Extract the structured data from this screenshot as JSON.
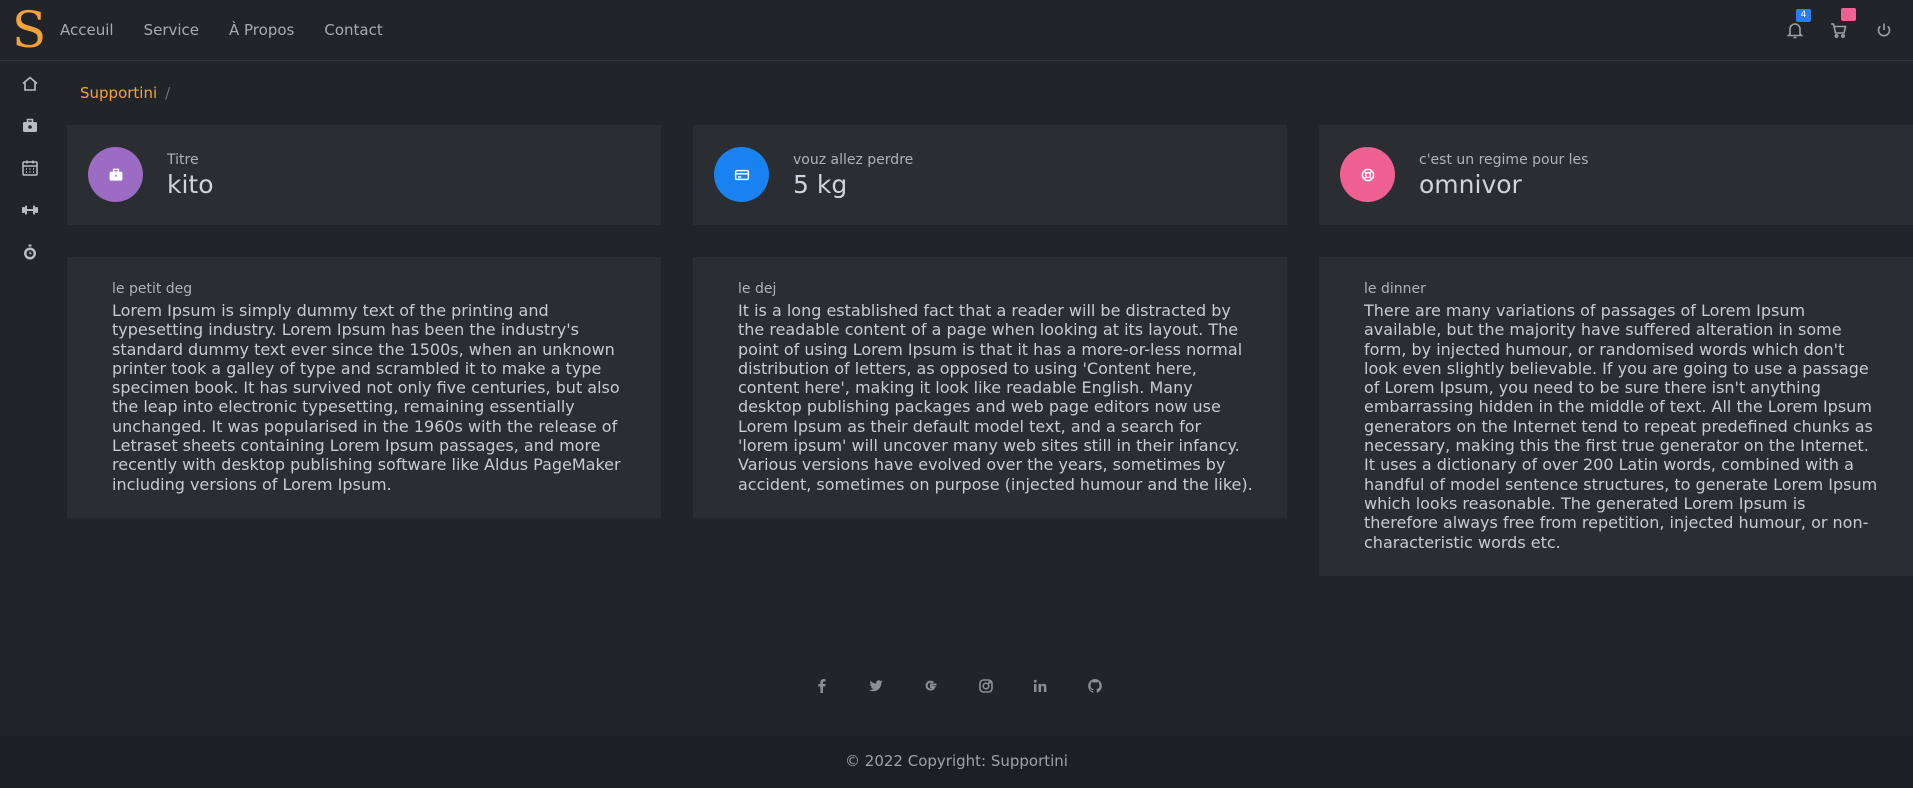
{
  "brand": {
    "logo_letter": "S"
  },
  "nav": {
    "items": [
      "Acceuil",
      "Service",
      "À Propos",
      "Contact"
    ]
  },
  "header_icons": {
    "notifications": {
      "icon": "bell-icon",
      "badge": "4",
      "badge_color": "#2b7ef0"
    },
    "cart": {
      "icon": "cart-icon",
      "badge": "",
      "badge_color": "#f06193"
    },
    "power": {
      "icon": "power-icon"
    }
  },
  "sidebar": {
    "items": [
      "home-icon",
      "briefcase-icon",
      "calendar-icon",
      "dumbbell-icon",
      "stopwatch-icon"
    ]
  },
  "breadcrumb": {
    "root": "Supportini",
    "separator": "/"
  },
  "stats": [
    {
      "label": "Titre",
      "value": "kito",
      "icon": "briefcase-icon",
      "color": "#9c6bc4"
    },
    {
      "label": "vouz allez perdre",
      "value": "5 kg",
      "icon": "credit-card-icon",
      "color": "#1a82f0"
    },
    {
      "label": "c'est un regime pour les",
      "value": "omnivor",
      "icon": "lifebuoy-icon",
      "color": "#f06193"
    }
  ],
  "meals": [
    {
      "label": "le petit deg",
      "text": "Lorem Ipsum is simply dummy text of the printing and typesetting industry. Lorem Ipsum has been the industry's standard dummy text ever since the 1500s, when an unknown printer took a galley of type and scrambled it to make a type specimen book. It has survived not only five centuries, but also the leap into electronic typesetting, remaining essentially unchanged. It was popularised in the 1960s with the release of Letraset sheets containing Lorem Ipsum passages, and more recently with desktop publishing software like Aldus PageMaker including versions of Lorem Ipsum."
    },
    {
      "label": "le dej",
      "text": "It is a long established fact that a reader will be distracted by the readable content of a page when looking at its layout. The point of using Lorem Ipsum is that it has a more-or-less normal distribution of letters, as opposed to using 'Content here, content here', making it look like readable English. Many desktop publishing packages and web page editors now use Lorem Ipsum as their default model text, and a search for 'lorem ipsum' will uncover many web sites still in their infancy. Various versions have evolved over the years, sometimes by accident, sometimes on purpose (injected humour and the like)."
    },
    {
      "label": "le dinner",
      "text": "There are many variations of passages of Lorem Ipsum available, but the majority have suffered alteration in some form, by injected humour, or randomised words which don't look even slightly believable. If you are going to use a passage of Lorem Ipsum, you need to be sure there isn't anything embarrassing hidden in the middle of text. All the Lorem Ipsum generators on the Internet tend to repeat predefined chunks as necessary, making this the first true generator on the Internet. It uses a dictionary of over 200 Latin words, combined with a handful of model sentence structures, to generate Lorem Ipsum which looks reasonable. The generated Lorem Ipsum is therefore always free from repetition, injected humour, or non-characteristic words etc."
    }
  ],
  "social": [
    "facebook-icon",
    "twitter-icon",
    "google-icon",
    "instagram-icon",
    "linkedin-icon",
    "github-icon"
  ],
  "footer": {
    "copyright": "© 2022 Copyright: Supportini"
  },
  "colors": {
    "accent": "#f2a33a",
    "background": "#212429",
    "card": "#2a2d32",
    "footer": "#1c1f23"
  }
}
